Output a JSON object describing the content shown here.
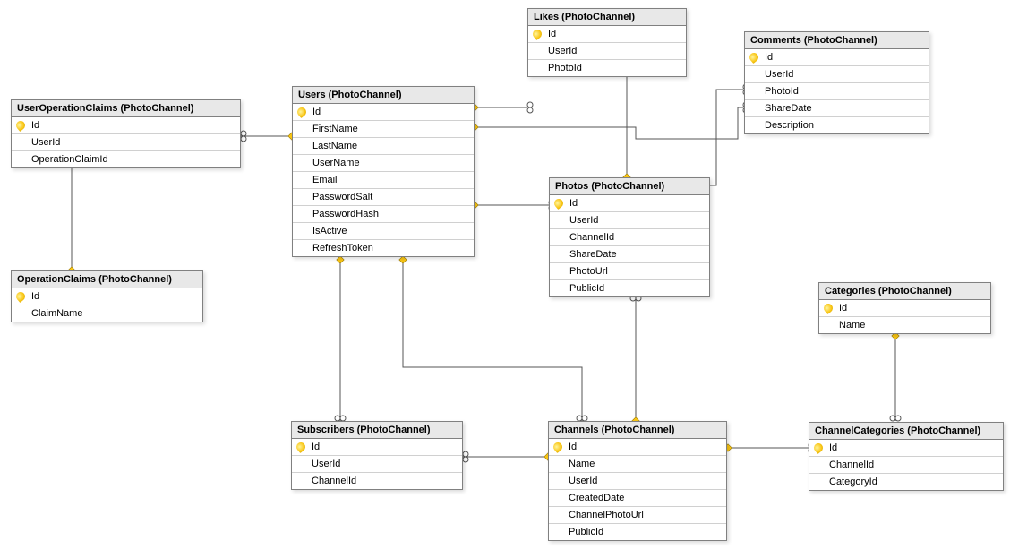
{
  "tables": {
    "userOperationClaims": {
      "title": "UserOperationClaims (PhotoChannel)",
      "cols": [
        "Id",
        "UserId",
        "OperationClaimId"
      ]
    },
    "operationClaims": {
      "title": "OperationClaims (PhotoChannel)",
      "cols": [
        "Id",
        "ClaimName"
      ]
    },
    "users": {
      "title": "Users (PhotoChannel)",
      "cols": [
        "Id",
        "FirstName",
        "LastName",
        "UserName",
        "Email",
        "PasswordSalt",
        "PasswordHash",
        "IsActive",
        "RefreshToken"
      ]
    },
    "likes": {
      "title": "Likes (PhotoChannel)",
      "cols": [
        "Id",
        "UserId",
        "PhotoId"
      ]
    },
    "comments": {
      "title": "Comments (PhotoChannel)",
      "cols": [
        "Id",
        "UserId",
        "PhotoId",
        "ShareDate",
        "Description"
      ]
    },
    "photos": {
      "title": "Photos (PhotoChannel)",
      "cols": [
        "Id",
        "UserId",
        "ChannelId",
        "ShareDate",
        "PhotoUrl",
        "PublicId"
      ]
    },
    "subscribers": {
      "title": "Subscribers (PhotoChannel)",
      "cols": [
        "Id",
        "UserId",
        "ChannelId"
      ]
    },
    "channels": {
      "title": "Channels (PhotoChannel)",
      "cols": [
        "Id",
        "Name",
        "UserId",
        "CreatedDate",
        "ChannelPhotoUrl",
        "PublicId"
      ]
    },
    "categories": {
      "title": "Categories (PhotoChannel)",
      "cols": [
        "Id",
        "Name"
      ]
    },
    "channelCategories": {
      "title": "ChannelCategories (PhotoChannel)",
      "cols": [
        "Id",
        "ChannelId",
        "CategoryId"
      ]
    }
  }
}
